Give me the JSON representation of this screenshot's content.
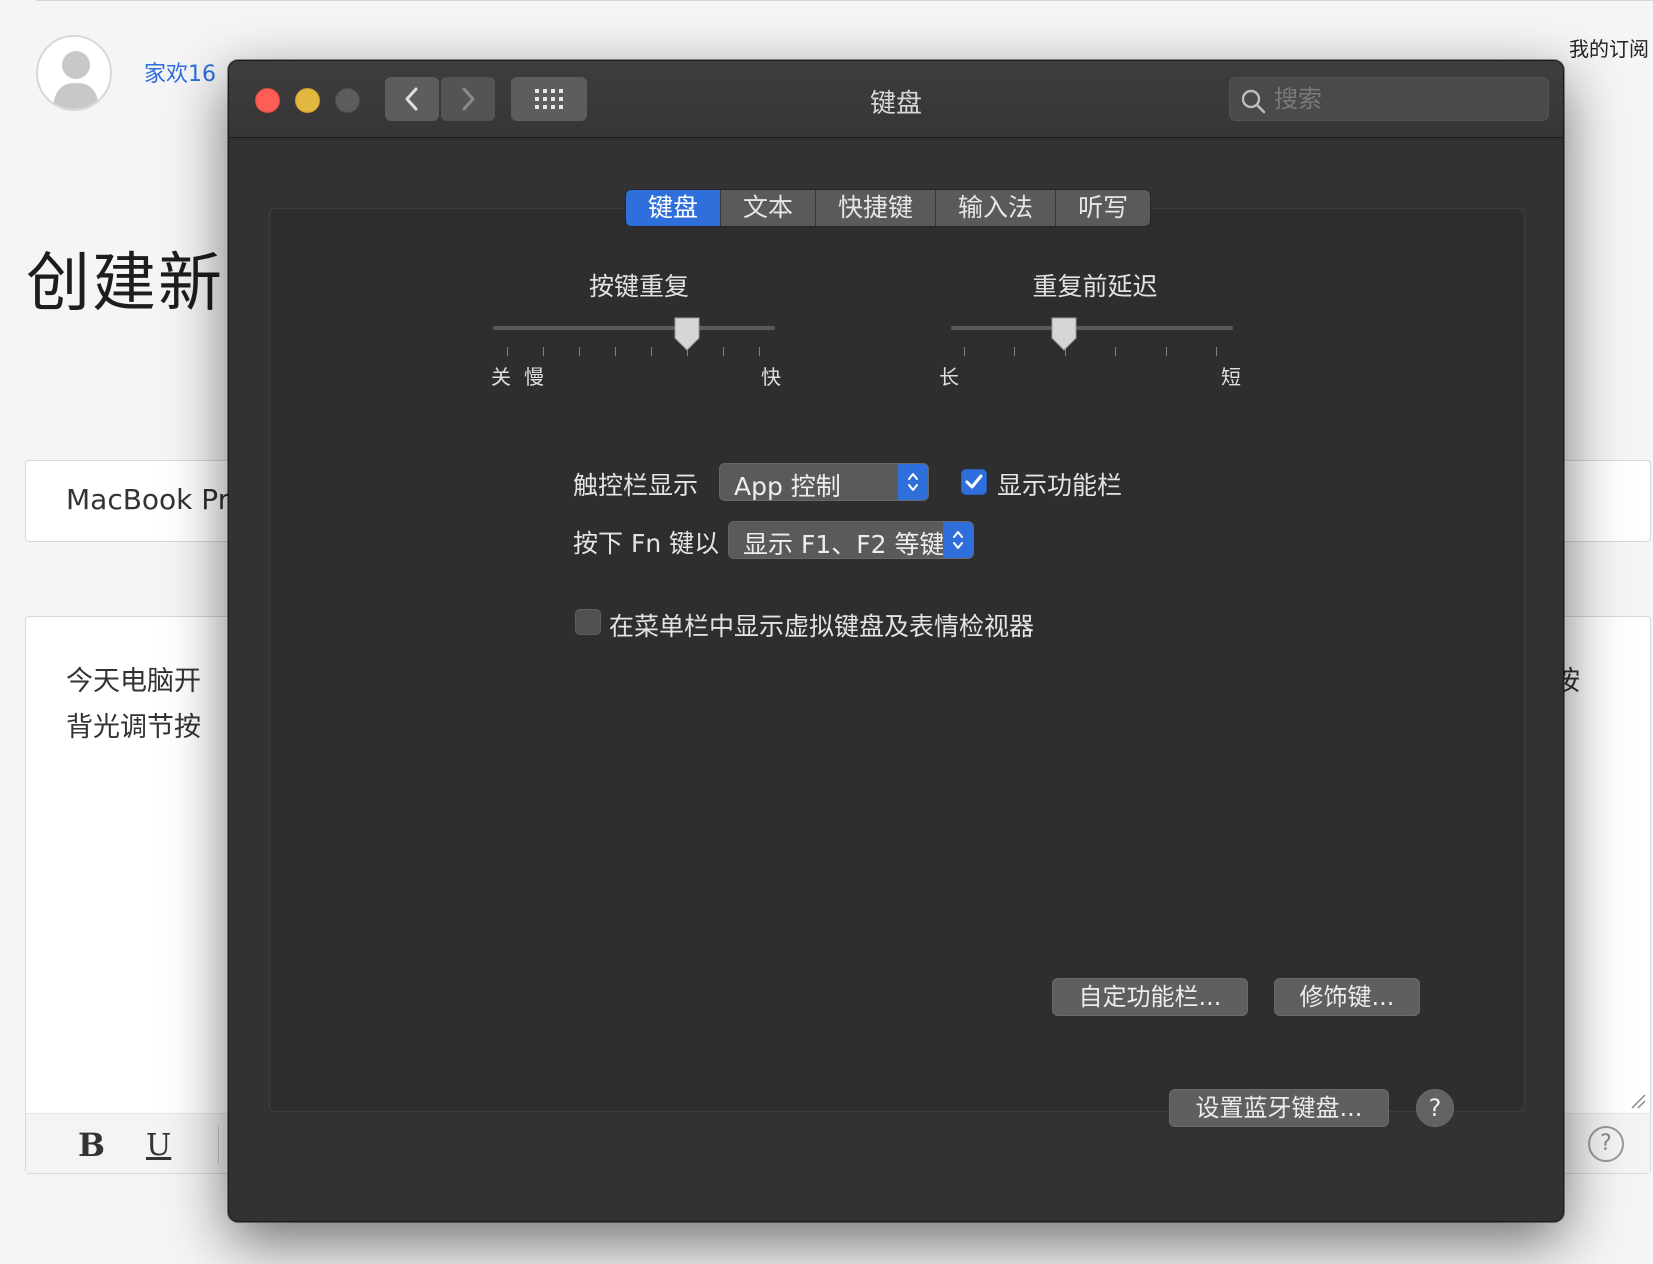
{
  "background_page": {
    "username": "家欢16",
    "subscribe_link": "我的订阅",
    "heading": "创建新",
    "title_input_value": "MacBook Pro",
    "editor_text_line1": "今天电脑开",
    "editor_text_line2": "背光调节按",
    "editor_text_right": "按",
    "toolbar": {
      "bold": "B",
      "underline": "U",
      "help": "?"
    }
  },
  "window": {
    "title": "键盘",
    "search_placeholder": "搜索",
    "tabs": [
      {
        "label": "键盘",
        "active": true
      },
      {
        "label": "文本",
        "active": false
      },
      {
        "label": "快捷键",
        "active": false
      },
      {
        "label": "输入法",
        "active": false
      },
      {
        "label": "听写",
        "active": false
      }
    ],
    "key_repeat": {
      "label": "按键重复",
      "min_label_off": "关",
      "min_label_slow": "慢",
      "max_label": "快",
      "ticks": 8,
      "value_position": 6
    },
    "delay_until_repeat": {
      "label": "重复前延迟",
      "min_label": "长",
      "max_label": "短",
      "ticks": 6,
      "value_position": 2
    },
    "touchbar_shows": {
      "label": "触控栏显示",
      "selected": "App 控制"
    },
    "show_control_strip": {
      "label": "显示功能栏",
      "checked": true
    },
    "fn_key": {
      "label": "按下 Fn 键以",
      "selected": "显示 F1、F2 等键"
    },
    "show_keyboard_viewer": {
      "label": "在菜单栏中显示虚拟键盘及表情检视器",
      "checked": false
    },
    "buttons": {
      "customize_control_strip": "自定功能栏...",
      "modifier_keys": "修饰键...",
      "bluetooth_keyboard": "设置蓝牙键盘...",
      "help": "?"
    },
    "colors": {
      "accent": "#2f6fdb",
      "window_bg": "#323232",
      "close": "#fd5f57",
      "minimize": "#e3b841"
    }
  }
}
